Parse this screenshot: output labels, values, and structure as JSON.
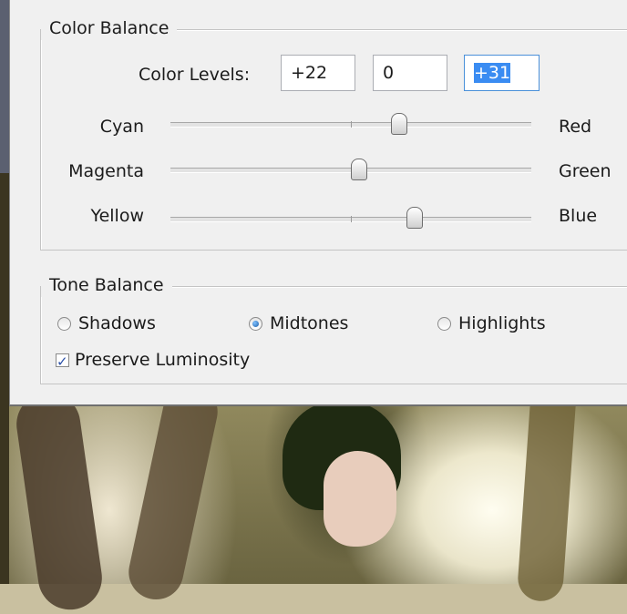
{
  "color_balance": {
    "title": "Color Balance",
    "levels_label": "Color Levels:",
    "levels": [
      "+22",
      "0",
      "+31"
    ],
    "sliders": [
      {
        "left": "Cyan",
        "right": "Red",
        "value": 22
      },
      {
        "left": "Magenta",
        "right": "Green",
        "value": 0
      },
      {
        "left": "Yellow",
        "right": "Blue",
        "value": 31
      }
    ]
  },
  "tone_balance": {
    "title": "Tone Balance",
    "options": [
      "Shadows",
      "Midtones",
      "Highlights"
    ],
    "selected": "Midtones",
    "preserve_label": "Preserve Luminosity",
    "preserve_checked": true
  },
  "colors": {
    "dialog_bg": "#f0f0f0",
    "selection": "#3a8cf2"
  }
}
